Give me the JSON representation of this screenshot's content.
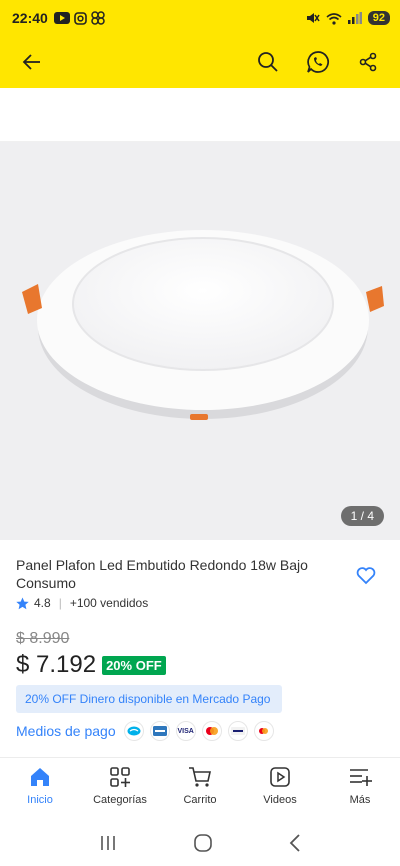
{
  "status_bar": {
    "time": "22:40",
    "left_icons": [
      "youtube-icon",
      "instagram-icon",
      "app-icon"
    ],
    "right_icons": [
      "mute-icon",
      "wifi-icon",
      "signal-icon"
    ],
    "battery": "92"
  },
  "app_bar": {
    "icons": [
      "back-arrow-icon",
      "search-icon",
      "whatsapp-icon",
      "share-icon"
    ]
  },
  "gallery": {
    "counter": "1 / 4"
  },
  "product": {
    "title": "Panel Plafon Led Embutido Redondo 18w Bajo Consumo",
    "rating": "4.8",
    "sold": "+100 vendidos",
    "old_price": "$ 8.990",
    "price": "$ 7.192",
    "discount": "20% OFF",
    "promo": "20% OFF Dinero disponible en Mercado Pago",
    "payment_label": "Medios de pago",
    "payment_methods": [
      "mercado-pago",
      "amex",
      "VISA",
      "mastercard",
      "visa-debito",
      "mastercard-debito"
    ]
  },
  "bottom_nav": {
    "items": [
      {
        "label": "Inicio",
        "icon": "home-icon",
        "active": true
      },
      {
        "label": "Categorías",
        "icon": "categories-icon",
        "active": false
      },
      {
        "label": "Carrito",
        "icon": "cart-icon",
        "active": false
      },
      {
        "label": "Videos",
        "icon": "video-icon",
        "active": false
      },
      {
        "label": "Más",
        "icon": "more-icon",
        "active": false
      }
    ]
  },
  "colors": {
    "brand_yellow": "#ffe600",
    "link_blue": "#3483fa",
    "discount_green": "#00a650"
  }
}
